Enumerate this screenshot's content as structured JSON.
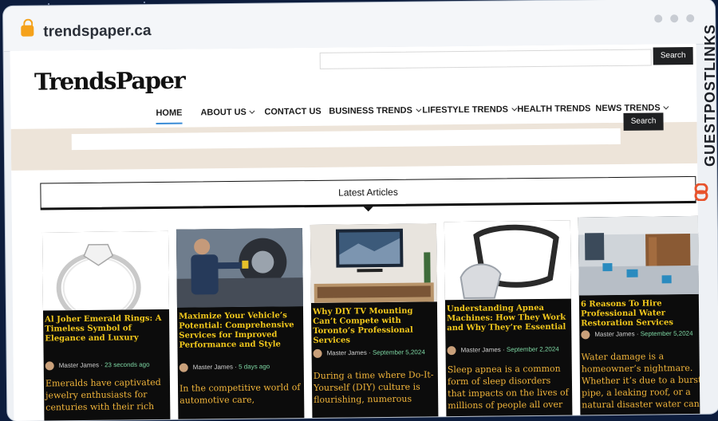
{
  "browser": {
    "url": "trendspaper.ca"
  },
  "header": {
    "logo": "TrendsPaper",
    "search_label": "Search"
  },
  "nav": {
    "items": [
      {
        "label": "HOME",
        "active": true
      },
      {
        "label": "ABOUT US",
        "dropdown": true
      },
      {
        "label": "CONTACT US"
      },
      {
        "label": "BUSINESS TRENDS",
        "dropdown": true
      },
      {
        "label": "LIFESTYLE TRENDS",
        "dropdown": true
      },
      {
        "label": "HEALTH TRENDS"
      },
      {
        "label": "NEWS TRENDS",
        "dropdown": true
      }
    ]
  },
  "subsearch": {
    "search_label": "Search"
  },
  "latest": {
    "heading": "Latest Articles"
  },
  "articles": [
    {
      "title": "Al Joher Emerald Rings: A Timeless Symbol of Elegance and Luxury",
      "author": "Master James",
      "date": "23 seconds ago",
      "excerpt": "Emeralds have captivated jewelry enthusiasts for centuries with their rich"
    },
    {
      "title": "Maximize Your Vehicle’s Potential: Comprehensive Services for Improved Performance and Style",
      "author": "Master James",
      "date": "5 days ago",
      "excerpt": "In the competitive world of automotive care,"
    },
    {
      "title": "Why DIY TV Mounting Can’t Compete with Toronto’s Professional Services",
      "author": "Master James",
      "date": "September 5,2024",
      "excerpt": "During a time where Do-It-Yourself (DIY) culture is flourishing, numerous"
    },
    {
      "title": "Understanding Apnea Machines: How They Work and Why They’re Essential",
      "author": "Master James",
      "date": "September 2,2024",
      "excerpt": "Sleep apnea is a common form of sleep disorders that impacts on the lives of millions of people all over"
    },
    {
      "title": "6 Reasons To Hire Professional Water Restoration Services",
      "author": "Master James",
      "date": "September 5,2024",
      "excerpt": "Water damage is a homeowner’s nightmare. Whether it’s due to a burst pipe, a leaking roof, or a natural disaster water can"
    }
  ],
  "watermark": {
    "text": "GUESTPOSTLINKS"
  }
}
